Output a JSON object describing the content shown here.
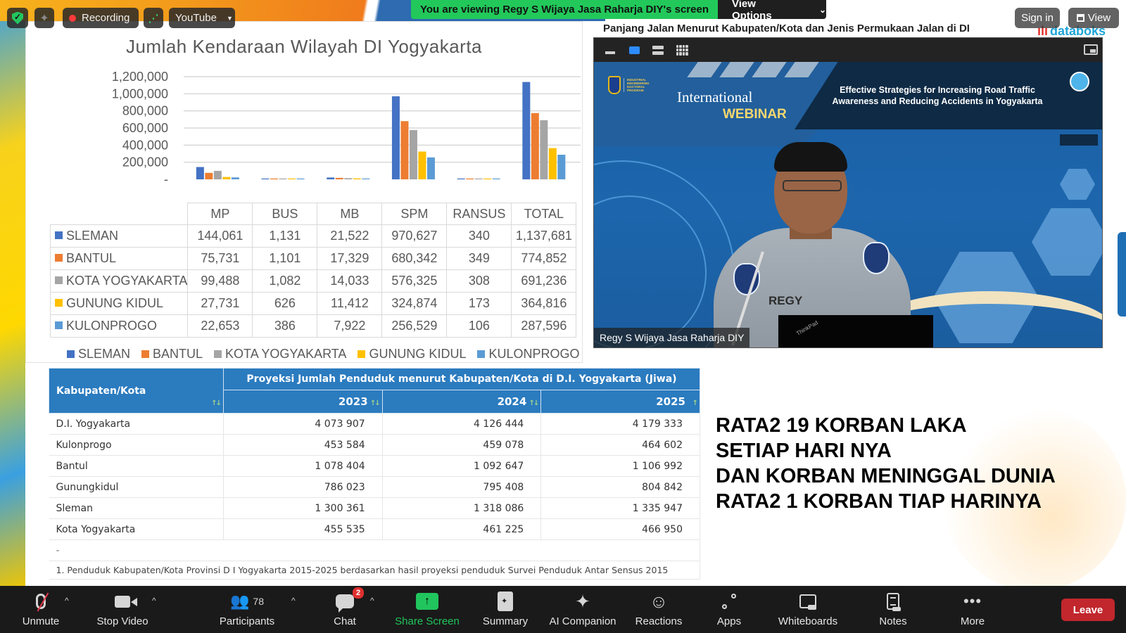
{
  "zoom_top": {
    "recording_label": "Recording",
    "stream_label": "YouTube",
    "viewing_banner": "You are viewing Regy S Wijaya Jasa Raharja DIY's screen",
    "view_options_label": "View Options",
    "sign_in_label": "Sign in",
    "view_label": "View"
  },
  "databoks": {
    "title": "Panjang Jalan Menurut Kabupaten/Kota dan Jenis Permukaan Jalan di DI",
    "logo": "databoks"
  },
  "video": {
    "participant_name": "Regy S Wijaya Jasa Raharja DIY",
    "banner_line1": "International",
    "banner_line2": "WEBINAR",
    "headline": "Effective Strategies for Increasing Road Traffic Awareness and Reducing Accidents in Yogyakarta",
    "univ_text": "INDUSTRIAL ENGINEERING DOCTORAL PROGRAM",
    "shirt_name": "REGY",
    "laptop_brand": "ThinkPad"
  },
  "chart_data": {
    "type": "bar",
    "title": "Jumlah Kendaraan Wilayah DI Yogyakarta",
    "categories": [
      "MP",
      "BUS",
      "MB",
      "SPM",
      "RANSUS",
      "TOTAL"
    ],
    "yticks": [
      "1,200,000",
      "1,000,000",
      "800,000",
      "600,000",
      "400,000",
      "200,000",
      "-"
    ],
    "ylim": [
      0,
      1200000
    ],
    "grid": true,
    "legend_position": "bottom",
    "series": [
      {
        "name": "SLEMAN",
        "color": "#4472c4",
        "values": [
          144061,
          1131,
          21522,
          970627,
          340,
          1137681
        ],
        "display": [
          "144,061",
          "1,131",
          "21,522",
          "970,627",
          "340",
          "1,137,681"
        ]
      },
      {
        "name": "BANTUL",
        "color": "#ed7d31",
        "values": [
          75731,
          1101,
          17329,
          680342,
          349,
          774852
        ],
        "display": [
          "75,731",
          "1,101",
          "17,329",
          "680,342",
          "349",
          "774,852"
        ]
      },
      {
        "name": "KOTA YOGYAKARTA",
        "color": "#a5a5a5",
        "values": [
          99488,
          1082,
          14033,
          576325,
          308,
          691236
        ],
        "display": [
          "99,488",
          "1,082",
          "14,033",
          "576,325",
          "308",
          "691,236"
        ]
      },
      {
        "name": "GUNUNG KIDUL",
        "color": "#ffc000",
        "values": [
          27731,
          626,
          11412,
          324874,
          173,
          364816
        ],
        "display": [
          "27,731",
          "626",
          "11,412",
          "324,874",
          "173",
          "364,816"
        ]
      },
      {
        "name": "KULONPROGO",
        "color": "#5b9bd5",
        "values": [
          22653,
          386,
          7922,
          256529,
          106,
          287596
        ],
        "display": [
          "22,653",
          "386",
          "7,922",
          "256,529",
          "106",
          "287,596"
        ]
      }
    ]
  },
  "population_table": {
    "col_header": "Kabupaten/Kota",
    "group_header": "Proyeksi Jumlah Penduduk menurut Kabupaten/Kota di D.I. Yogyakarta (Jiwa)",
    "years": [
      "2023",
      "2024",
      "2025"
    ],
    "rows": [
      {
        "name": "D.I. Yogyakarta",
        "values": [
          "4 073 907",
          "4 126 444",
          "4 179 333"
        ]
      },
      {
        "name": "Kulonprogo",
        "values": [
          "453 584",
          "459 078",
          "464 602"
        ]
      },
      {
        "name": "Bantul",
        "values": [
          "1 078 404",
          "1 092 647",
          "1 106 992"
        ]
      },
      {
        "name": "Gunungkidul",
        "values": [
          "786 023",
          "795 408",
          "804 842"
        ]
      },
      {
        "name": "Sleman",
        "values": [
          "1 300 361",
          "1 318 086",
          "1 335 947"
        ]
      },
      {
        "name": "Kota Yogyakarta",
        "values": [
          "455 535",
          "461 225",
          "466 950"
        ]
      }
    ],
    "note": "-",
    "footnote": "1. Penduduk Kabupaten/Kota Provinsi D I Yogyakarta 2015-2025 berdasarkan hasil proyeksi penduduk Survei Penduduk Antar Sensus 2015"
  },
  "statement": {
    "lines": [
      "RATA2 19 KORBAN LAKA",
      "SETIAP HARI NYA",
      "DAN KORBAN MENINGGAL DUNIA",
      "RATA2 1 KORBAN TIAP HARINYA"
    ]
  },
  "toolbar": {
    "unmute": "Unmute",
    "stop_video": "Stop Video",
    "participants": "Participants",
    "participants_count": "78",
    "chat": "Chat",
    "chat_badge": "2",
    "share_screen": "Share Screen",
    "summary": "Summary",
    "ai_companion": "AI Companion",
    "reactions": "Reactions",
    "apps": "Apps",
    "whiteboards": "Whiteboards",
    "notes": "Notes",
    "more": "More",
    "leave": "Leave"
  }
}
